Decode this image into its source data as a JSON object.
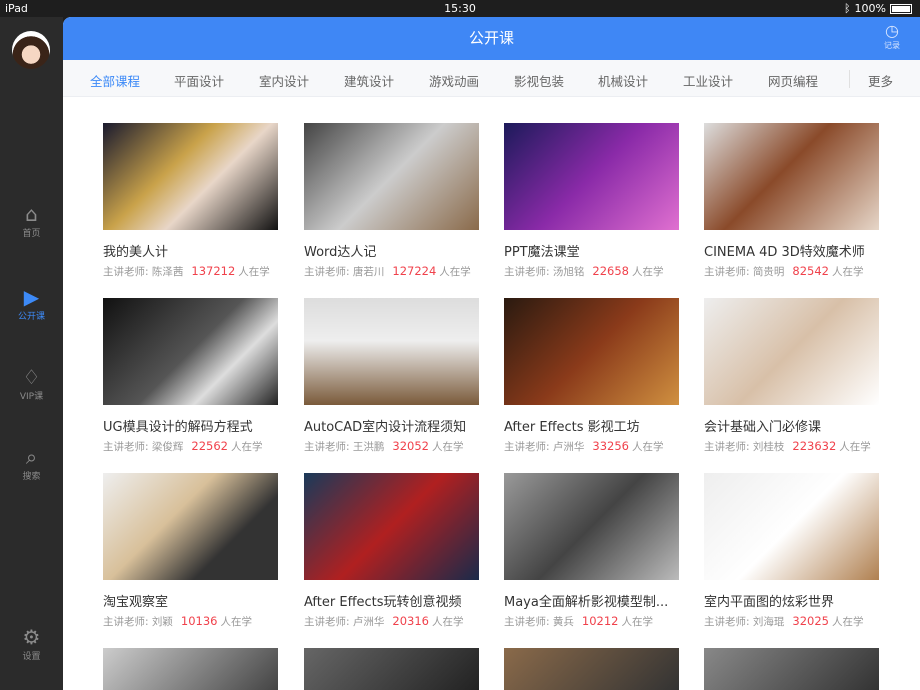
{
  "status": {
    "device": "iPad",
    "time": "15:30",
    "battery": "100%"
  },
  "sidebar": {
    "items": [
      {
        "label": "首页",
        "icon": "home-icon",
        "glyph": "⌂"
      },
      {
        "label": "公开课",
        "icon": "video-icon",
        "glyph": "▶"
      },
      {
        "label": "VIP课",
        "icon": "diamond-icon",
        "glyph": "♢"
      },
      {
        "label": "搜索",
        "icon": "search-icon",
        "glyph": "⌕"
      },
      {
        "label": "设置",
        "icon": "gear-icon",
        "glyph": "⚙"
      }
    ]
  },
  "header": {
    "title": "公开课",
    "record_label": "记录"
  },
  "tabs": [
    "全部课程",
    "平面设计",
    "室内设计",
    "建筑设计",
    "游戏动画",
    "影视包装",
    "机械设计",
    "工业设计",
    "网页编程"
  ],
  "more_label": "更多",
  "teacher_prefix": "主讲老师:",
  "learning_suffix": "人在学",
  "accent": "#3f87f5",
  "courses": [
    {
      "title": "我的美人计",
      "teacher": "陈泽茜",
      "count": "137212"
    },
    {
      "title": "Word达人记",
      "teacher": "唐若川",
      "count": "127224"
    },
    {
      "title": "PPT魔法课堂",
      "teacher": "汤旭铭",
      "count": "22658"
    },
    {
      "title": "CINEMA 4D 3D特效魔术师",
      "teacher": "简贵明",
      "count": "82542"
    },
    {
      "title": "UG模具设计的解码方程式",
      "teacher": "梁俊辉",
      "count": "22562"
    },
    {
      "title": "AutoCAD室内设计流程须知",
      "teacher": "王洪鹏",
      "count": "32052"
    },
    {
      "title": "After Effects 影视工坊",
      "teacher": "卢洲华",
      "count": "33256"
    },
    {
      "title": "会计基础入门必修课",
      "teacher": "刘桂枝",
      "count": "223632"
    },
    {
      "title": "淘宝观察室",
      "teacher": "刘颖",
      "count": "10136"
    },
    {
      "title": "After Effects玩转创意视频",
      "teacher": "卢洲华",
      "count": "20316"
    },
    {
      "title": "Maya全面解析影视模型制...",
      "teacher": "黄兵",
      "count": "10212"
    },
    {
      "title": "室内平面图的炫彩世界",
      "teacher": "刘海琨",
      "count": "32025"
    }
  ]
}
